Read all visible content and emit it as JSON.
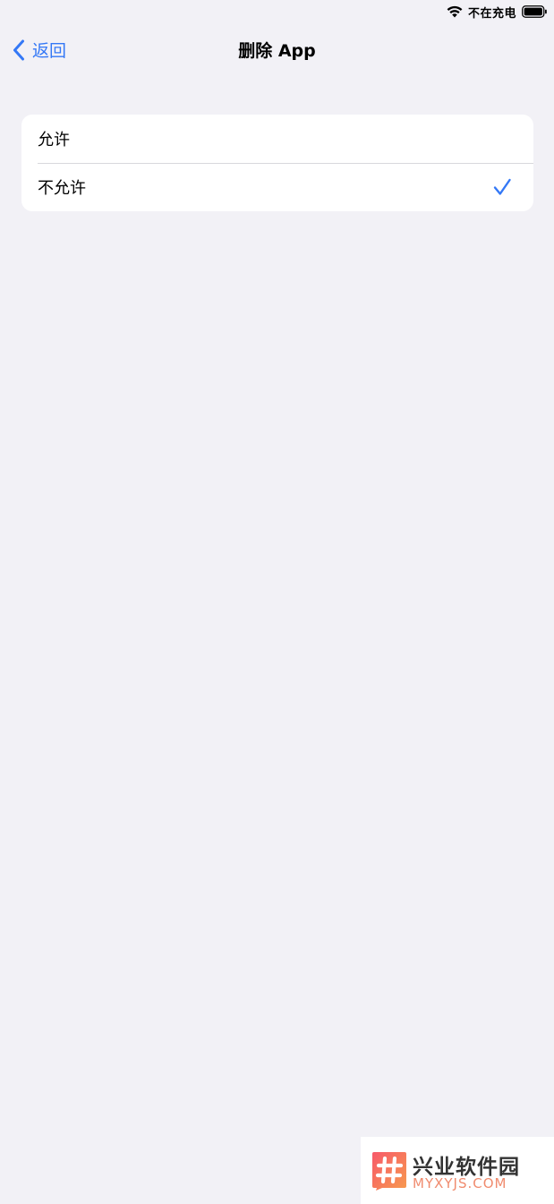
{
  "status_bar": {
    "charging_text": "不在充电",
    "wifi_icon": "wifi-icon",
    "battery_icon": "battery-icon"
  },
  "nav": {
    "back_label": "返回",
    "back_icon": "chevron-left-icon",
    "title": "删除 App"
  },
  "options": [
    {
      "label": "允许",
      "selected": false
    },
    {
      "label": "不允许",
      "selected": true
    }
  ],
  "colors": {
    "accent": "#3478f6",
    "background": "#f2f1f6",
    "card": "#ffffff"
  },
  "watermark": {
    "title": "兴业软件园",
    "subtitle": "MYXYJS.COM"
  }
}
